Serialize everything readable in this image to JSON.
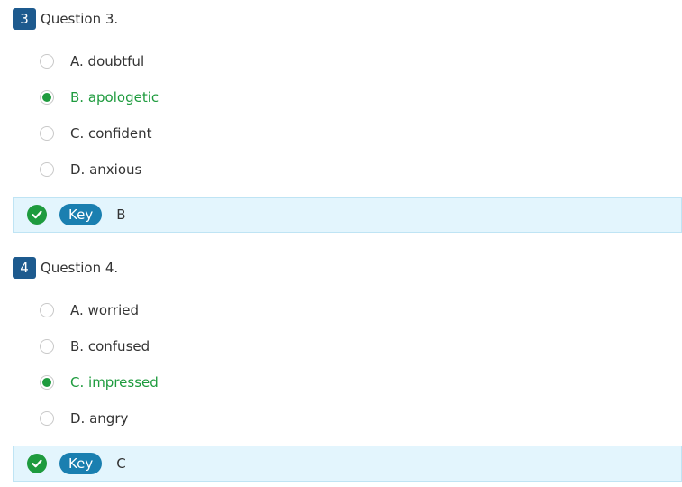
{
  "questions": [
    {
      "number": "3",
      "title": "Question 3.",
      "options": [
        {
          "letter": "A.",
          "text": "doubtful",
          "selected": false
        },
        {
          "letter": "B.",
          "text": "apologetic",
          "selected": true
        },
        {
          "letter": "C.",
          "text": "confident",
          "selected": false
        },
        {
          "letter": "D.",
          "text": "anxious",
          "selected": false
        }
      ],
      "key_label": "Key",
      "key_value": "B"
    },
    {
      "number": "4",
      "title": "Question 4.",
      "options": [
        {
          "letter": "A.",
          "text": "worried",
          "selected": false
        },
        {
          "letter": "B.",
          "text": "confused",
          "selected": false
        },
        {
          "letter": "C.",
          "text": "impressed",
          "selected": true
        },
        {
          "letter": "D.",
          "text": "angry",
          "selected": false
        }
      ],
      "key_label": "Key",
      "key_value": "C"
    }
  ],
  "colors": {
    "badge": "#1d5a8e",
    "selected": "#1e9b3e",
    "key_pill": "#1a7fb0",
    "key_bar_bg": "#e3f5fd"
  },
  "icons": {
    "correct": "check-circle-icon",
    "radio": "radio-icon"
  }
}
